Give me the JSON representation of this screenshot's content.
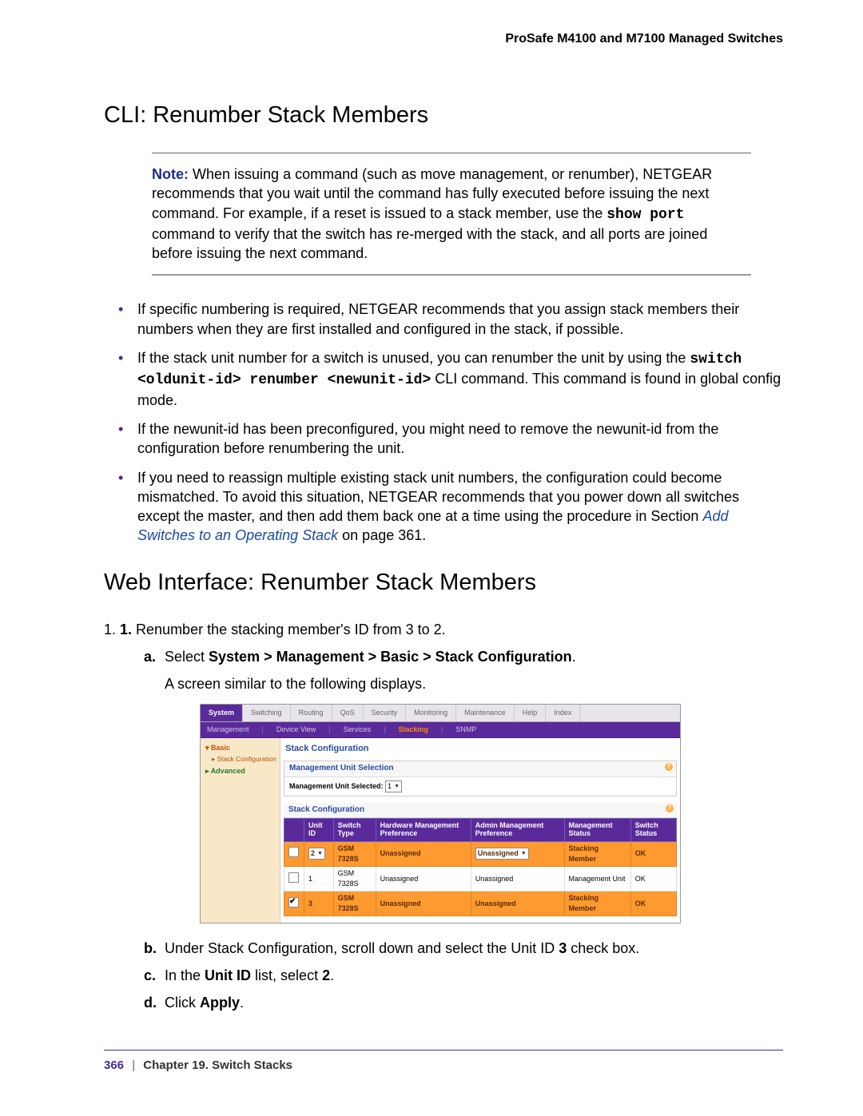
{
  "header": "ProSafe M4100 and M7100 Managed Switches",
  "h1_cli": "CLI: Renumber Stack Members",
  "note": {
    "label": "Note:",
    "body_pre": "When issuing a command (such as move management, or renumber), NETGEAR recommends that you wait until the command has fully executed before issuing the next command. For example, if a reset is issued to a stack member, use the ",
    "cmd": "show port",
    "body_post": " command to verify that the switch has re-merged with the stack, and all ports are joined before issuing the next command."
  },
  "bullets": {
    "b1": "If specific numbering is required, NETGEAR recommends that you assign stack members their numbers when they are first installed and configured in the stack, if possible.",
    "b2_pre": "If the stack unit number for a switch is unused, you can renumber the unit by using the ",
    "b2_cmd": "switch <oldunit-id> renumber <newunit-id>",
    "b2_post": " CLI command. This command is found in global config mode.",
    "b3": "If the newunit-id has been preconfigured, you might need to remove the newunit-id from the configuration before renumbering the unit.",
    "b4_pre": "If you need to reassign multiple existing stack unit numbers, the configuration could become mismatched. To avoid this situation, NETGEAR recommends that you power down all switches except the master, and then add them back one at a time using the procedure in Section ",
    "b4_link": "Add Switches to an Operating Stack",
    "b4_post": " on page 361."
  },
  "h1_web": "Web Interface: Renumber Stack Members",
  "steps": {
    "s1": "Renumber the stacking member's ID from 3 to 2.",
    "a_pre": "Select ",
    "a_bold": "System > Management > Basic > Stack Configuration",
    "a_post": ".",
    "a_after": "A screen similar to the following displays.",
    "b_pre": "Under Stack Configuration, scroll down and select the Unit ID ",
    "b_bold": "3",
    "b_post": " check box.",
    "c_pre": "In the ",
    "c_bold1": "Unit ID",
    "c_mid": " list, select ",
    "c_bold2": "2",
    "c_post": ".",
    "d_pre": "Click ",
    "d_bold": "Apply",
    "d_post": "."
  },
  "ui": {
    "tabs1": [
      "System",
      "Switching",
      "Routing",
      "QoS",
      "Security",
      "Monitoring",
      "Maintenance",
      "Help",
      "Index"
    ],
    "tabs2": [
      "Management",
      "Device View",
      "Services",
      "Stacking",
      "SNMP"
    ],
    "side": {
      "basic": "Basic",
      "stack": "Stack Configuration",
      "advanced": "Advanced"
    },
    "title": "Stack Configuration",
    "sec1": {
      "head": "Management Unit Selection",
      "label": "Management Unit Selected:",
      "value": "1"
    },
    "sec2": {
      "head": "Stack Configuration",
      "cols": [
        "Unit ID",
        "Switch Type",
        "Hardware Management Preference",
        "Admin Management Preference",
        "Management Status",
        "Switch Status"
      ],
      "rows": [
        {
          "checked": false,
          "highlight": true,
          "unit_select": true,
          "unit": "2",
          "type": "GSM 7328S",
          "hw": "Unassigned",
          "admin_select": true,
          "admin": "Unassigned",
          "mgmt": "Stacking Member",
          "status": "OK"
        },
        {
          "checked": false,
          "highlight": false,
          "unit_select": false,
          "unit": "1",
          "type": "GSM 7328S",
          "hw": "Unassigned",
          "admin_select": false,
          "admin": "Unassigned",
          "mgmt": "Management Unit",
          "status": "OK"
        },
        {
          "checked": true,
          "highlight": true,
          "unit_select": false,
          "unit": "3",
          "type": "GSM 7328S",
          "hw": "Unassigned",
          "admin_select": false,
          "admin": "Unassigned",
          "mgmt": "Stacking Member",
          "status": "OK"
        }
      ]
    }
  },
  "footer": {
    "page": "366",
    "chapter": "Chapter 19.  Switch Stacks"
  }
}
